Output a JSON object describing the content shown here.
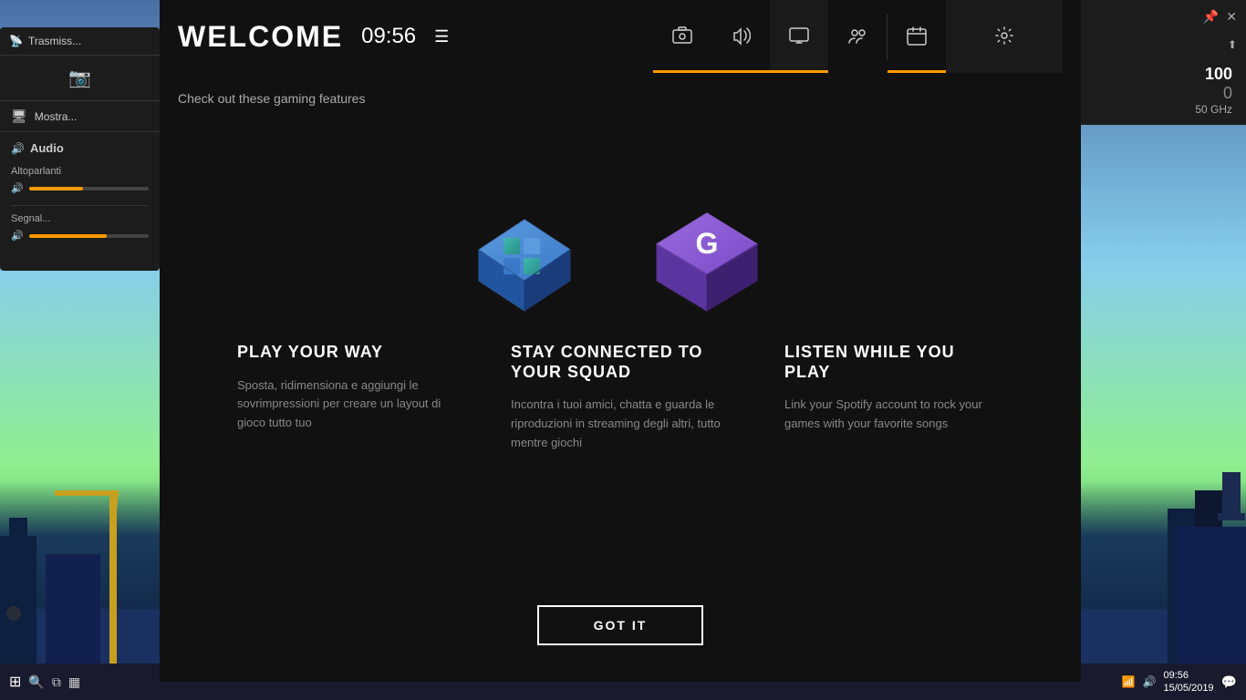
{
  "app": {
    "title": "WELCOME",
    "subtitle": "Check out these gaming features",
    "time": "09:56"
  },
  "nav": {
    "icons": [
      {
        "name": "capture-icon",
        "label": "Capture",
        "active": true
      },
      {
        "name": "audio-icon-nav",
        "label": "Audio",
        "active": true
      },
      {
        "name": "display-icon",
        "label": "Display",
        "active": true
      },
      {
        "name": "social-icon",
        "label": "Social",
        "active": false
      },
      {
        "name": "calendar-icon",
        "label": "Calendar",
        "active": true
      },
      {
        "name": "settings-icon",
        "label": "Settings",
        "active": false
      }
    ]
  },
  "left_panel": {
    "capture_label": "Trasmiss...",
    "mostra_label": "Mostra...",
    "audio_label": "Audio",
    "altoparlanti_label": "Altoparlanti",
    "segnale_label": "Segnal..."
  },
  "features": [
    {
      "title": "PLAY YOUR WAY",
      "description": "Sposta, ridimensiona e aggiungi le sovrimpressioni per creare un layout di gioco tutto tuo"
    },
    {
      "title": "STAY CONNECTED TO YOUR SQUAD",
      "description": "Incontra i tuoi amici, chatta e guarda le riproduzioni in streaming degli altri, tutto mentre giochi"
    },
    {
      "title": "LISTEN WHILE YOU PLAY",
      "description": "Link your Spotify account to rock your games with your favorite songs"
    }
  ],
  "buttons": {
    "got_it": "GOT IT"
  },
  "right_panel": {
    "stat_100": "100",
    "stat_0": "0",
    "freq": "50 GHz"
  },
  "taskbar": {
    "time": "09:56",
    "date": "15/05/2019"
  }
}
